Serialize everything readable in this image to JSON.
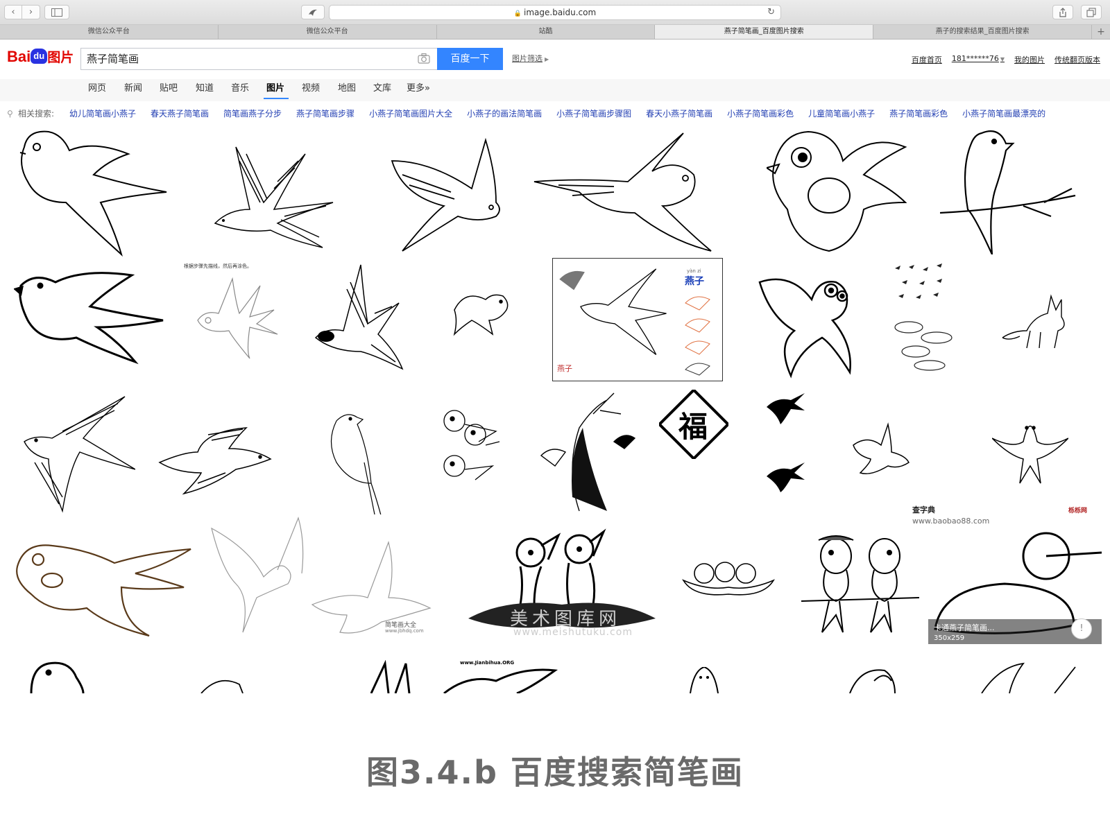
{
  "browser": {
    "nav_back": "‹",
    "nav_forward": "›",
    "url": "image.baidu.com",
    "tabs": [
      {
        "label": "微信公众平台",
        "active": false
      },
      {
        "label": "微信公众平台",
        "active": false
      },
      {
        "label": "站酷",
        "active": false
      },
      {
        "label": "燕子简笔画_百度图片搜索",
        "active": true
      },
      {
        "label": "燕子的搜索结果_百度图片搜索",
        "active": false
      }
    ],
    "new_tab": "+"
  },
  "header": {
    "logo_bai": "Bai",
    "logo_du": "du",
    "logo_tupian": "图片",
    "search_value": "燕子简笔画",
    "search_button": "百度一下",
    "filter_link": "图片筛选",
    "links": {
      "home": "百度首页",
      "user": "181******76",
      "my_images": "我的图片",
      "classic": "传统翻页版本"
    }
  },
  "channels": [
    "网页",
    "新闻",
    "贴吧",
    "知道",
    "音乐",
    "图片",
    "视频",
    "地图",
    "文库",
    "更多»"
  ],
  "active_channel": "图片",
  "related": {
    "label": "相关搜索:",
    "items": [
      "幼儿简笔画小燕子",
      "春天燕子简笔画",
      "简笔画燕子分步",
      "燕子简笔画步骤",
      "小燕子简笔画图片大全",
      "小燕子的画法简笔画",
      "小燕子简笔画步骤图",
      "春天小燕子简笔画",
      "小燕子简笔画彩色",
      "儿童简笔画小燕子",
      "燕子简笔画彩色",
      "小燕子简笔画最漂亮的"
    ]
  },
  "tiles": {
    "r2c2_note": "根据步骤先描线，然后再涂色。",
    "r2c5_title": "燕子",
    "r2c5_pinyin": "yàn zi",
    "r2c5_bottom": "燕子",
    "r3c6_fu": "福",
    "r3c7_brand": "查字典",
    "r3c8_site": "www.baobao88.com",
    "r3c8_mark": "栎栎网",
    "r4c2_brand": "简笔画大全",
    "r4c2_site": "www.jbhdq.com",
    "r4c3_watermark": "美术图库网",
    "r4c3_site": "www.meishutuku.com",
    "r4c8_title": "卡通燕子简笔画...",
    "r4c8_size": "350x259",
    "r5c4_site": "www.Jianbihua.ORG"
  },
  "feedback": "!",
  "figure_caption": "图3.4.b 百度搜索简笔画"
}
